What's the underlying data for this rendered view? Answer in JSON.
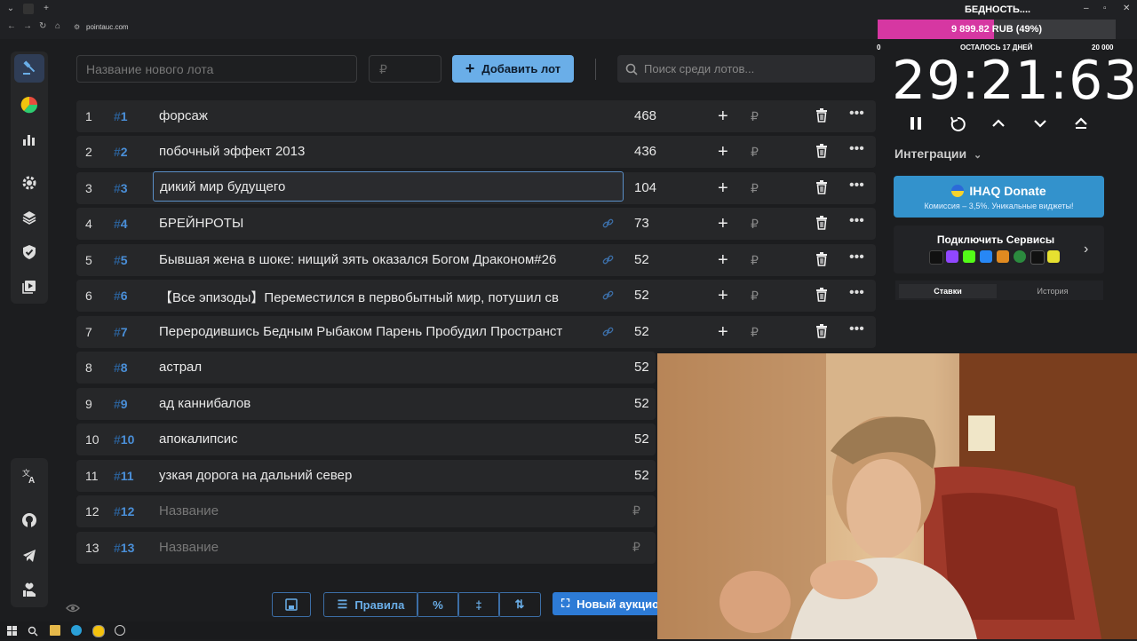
{
  "browser": {
    "url": "pointauc.com",
    "window_title": "БЕДНОСТЬ....",
    "win_controls": [
      "–",
      "▫",
      "✕"
    ]
  },
  "toolbar": {
    "new_lot_placeholder": "Название нового лота",
    "amount_placeholder": "₽",
    "add_button": "Добавить лот",
    "search_placeholder": "Поиск среди лотов..."
  },
  "lots": [
    {
      "num": "1",
      "id": "1",
      "name": "форсаж",
      "amount": "468",
      "link": false,
      "actions": true
    },
    {
      "num": "2",
      "id": "2",
      "name": "побочный эффект 2013",
      "amount": "436",
      "link": false,
      "actions": true
    },
    {
      "num": "3",
      "id": "3",
      "name": "дикий мир будущего",
      "amount": "104",
      "link": false,
      "actions": true,
      "editing": true
    },
    {
      "num": "4",
      "id": "4",
      "name": "БРЕЙНРОТЫ",
      "amount": "73",
      "link": true,
      "actions": true
    },
    {
      "num": "5",
      "id": "5",
      "name": "Бывшая жена в шоке: нищий зять оказался Богом Драконом#26",
      "amount": "52",
      "link": true,
      "actions": true
    },
    {
      "num": "6",
      "id": "6",
      "name": "【Все эпизоды】Переместился в первобытный мир, потушил св",
      "amount": "52",
      "link": true,
      "actions": true
    },
    {
      "num": "7",
      "id": "7",
      "name": "Переродившись Бедным Рыбаком Парень Пробудил Пространст",
      "amount": "52",
      "link": true,
      "actions": true
    },
    {
      "num": "8",
      "id": "8",
      "name": "астрал",
      "amount": "52"
    },
    {
      "num": "9",
      "id": "9",
      "name": "ад каннибалов",
      "amount": "52"
    },
    {
      "num": "10",
      "id": "10",
      "name": "апокалипсис",
      "amount": "52"
    },
    {
      "num": "11",
      "id": "11",
      "name": "узкая дорога на дальний север",
      "amount": "52"
    },
    {
      "num": "12",
      "id": "12",
      "name": "Название",
      "amount": "₽",
      "placeholder": true
    },
    {
      "num": "13",
      "id": "13",
      "name": "Название",
      "amount": "₽",
      "placeholder": true
    }
  ],
  "row_symbols": {
    "hash": "#",
    "plus": "+",
    "rub": "₽",
    "more": "•••"
  },
  "bottom": {
    "rules_label": "Правила",
    "percent_label": "%",
    "new_auction_label": "Новый аукцион"
  },
  "goal": {
    "amount_text": "9 899.82 RUB (49%)",
    "fraction": 0.49,
    "min": "0",
    "remaining": "ОСТАЛОСЬ 17 ДНЕЙ",
    "max": "20 000"
  },
  "timer": {
    "value": "29:21:63"
  },
  "panel": {
    "integrations_label": "Интеграции",
    "donate_title": "IHAQ Donate",
    "donate_sub": "Комиссия – 3,5%. Уникальные виджеты!",
    "services_title": "Подключить Сервисы",
    "tab_bids": "Ставки",
    "tab_history": "История"
  },
  "colors": {
    "accent": "#6aaee8",
    "goal_fill": "#d637a2",
    "donate_bg": "#3392cc"
  }
}
